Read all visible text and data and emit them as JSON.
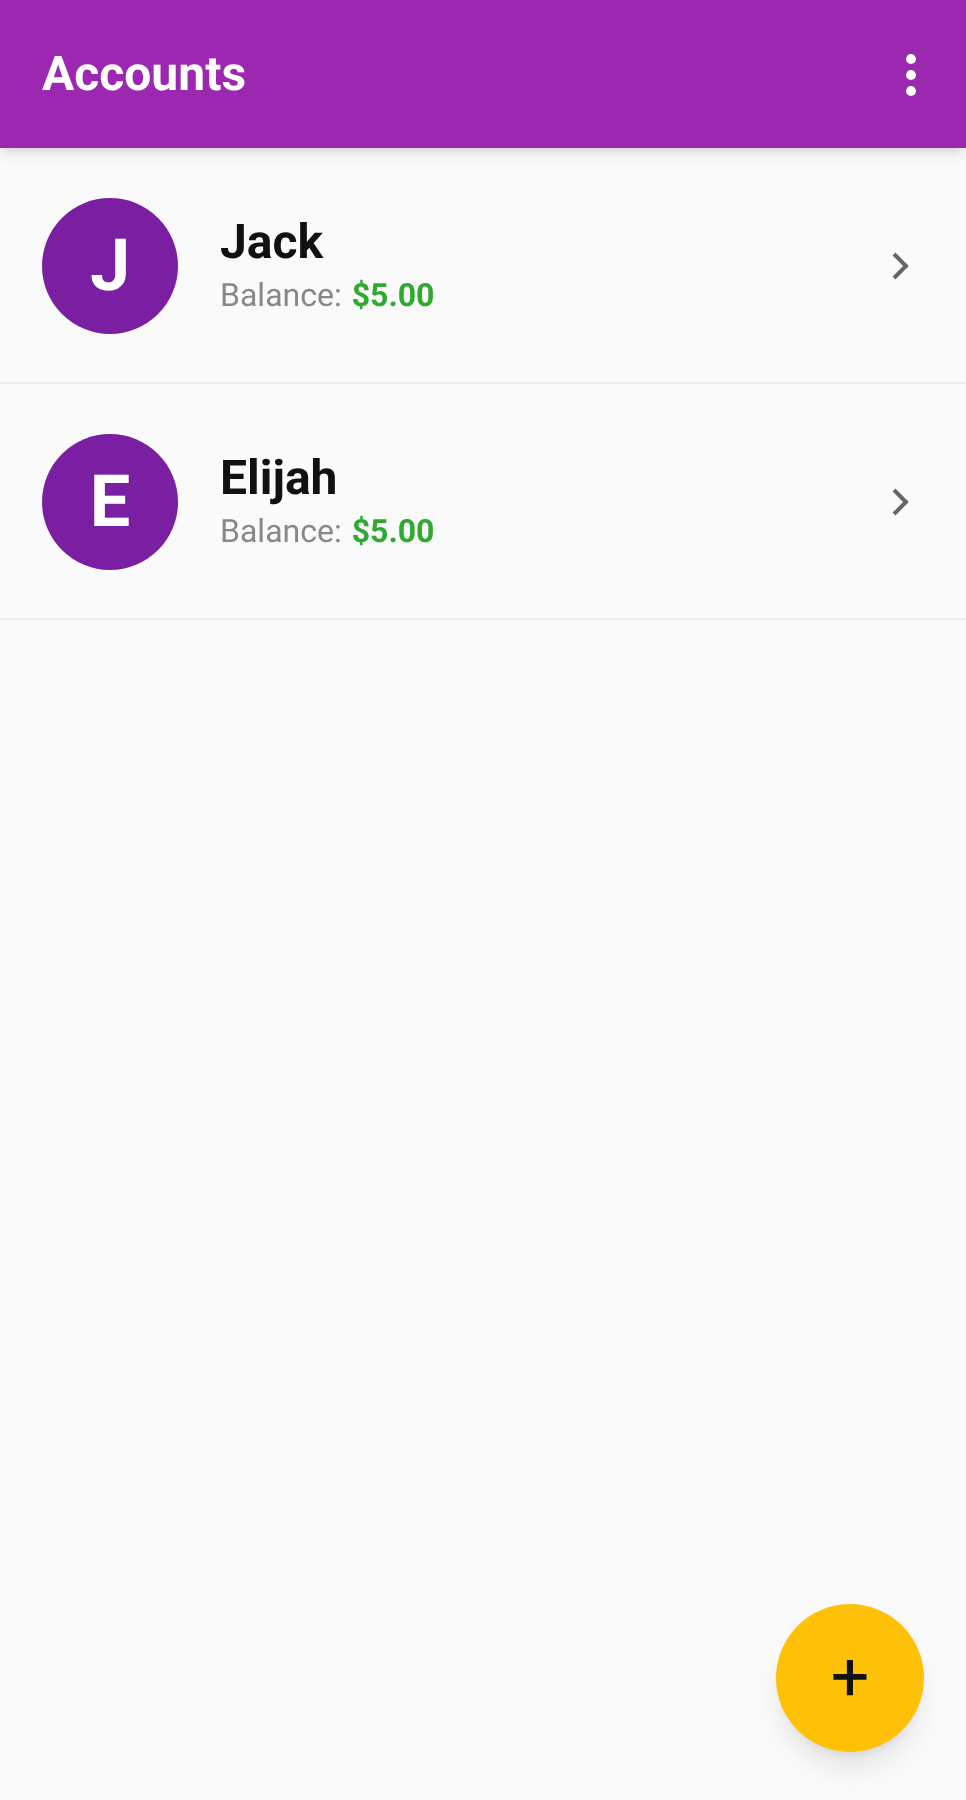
{
  "app_bar": {
    "title": "Accounts"
  },
  "accounts": [
    {
      "initial": "J",
      "name": "Jack",
      "balance_label": "Balance:",
      "balance": "$5.00"
    },
    {
      "initial": "E",
      "name": "Elijah",
      "balance_label": "Balance:",
      "balance": "$5.00"
    }
  ],
  "fab": {
    "label": "+"
  }
}
